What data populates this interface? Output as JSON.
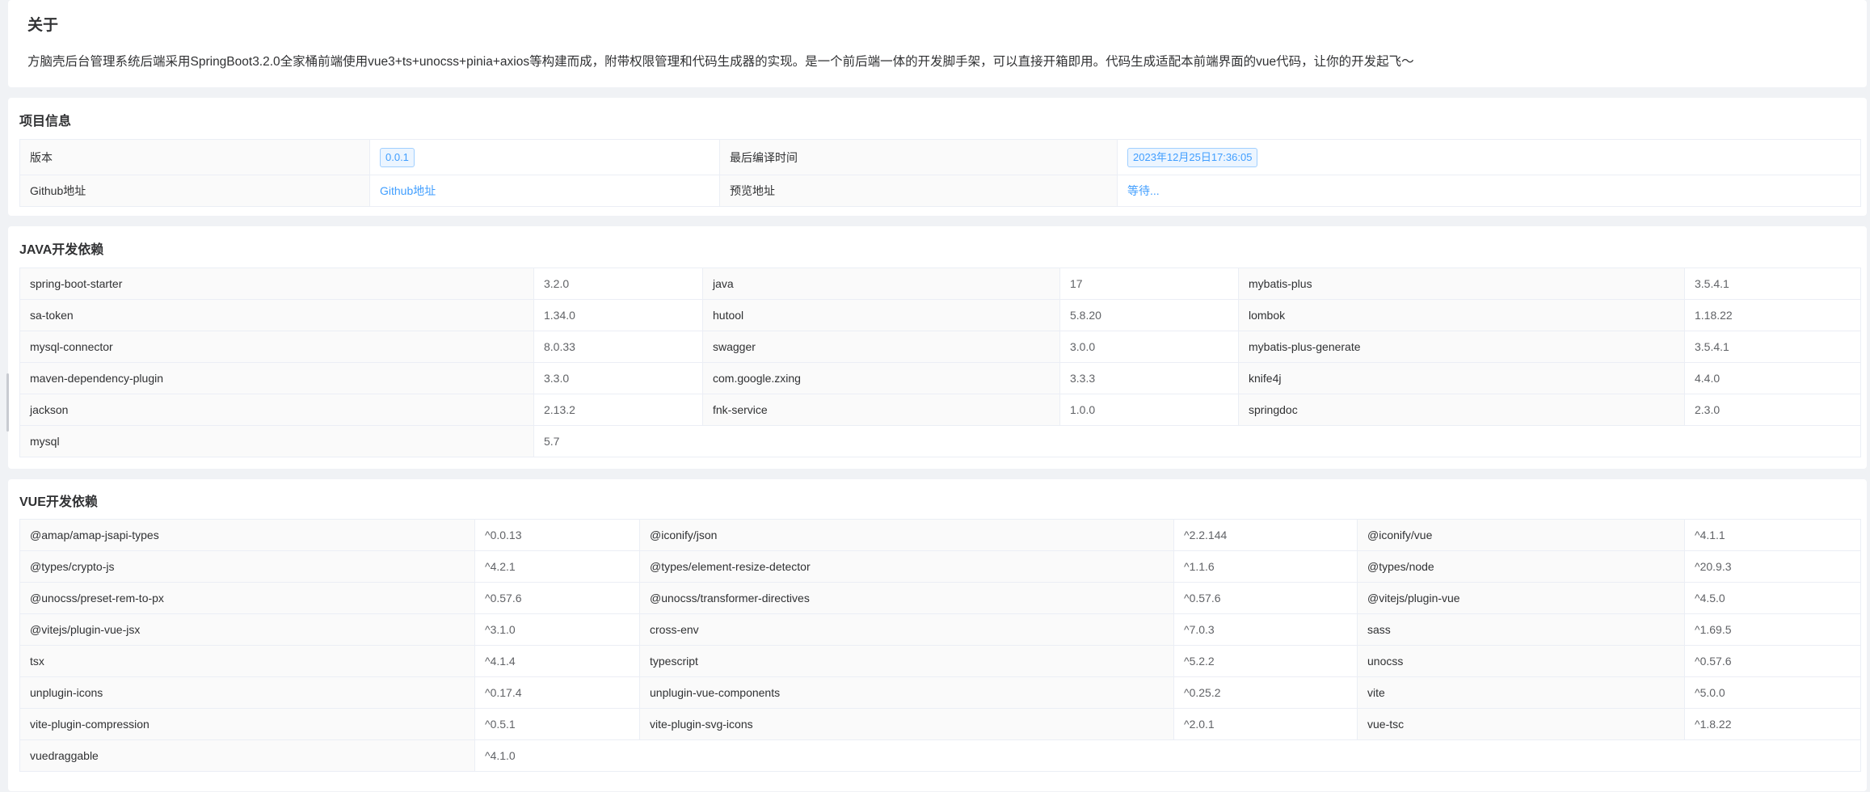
{
  "about": {
    "title": "关于",
    "text": "方脑壳后台管理系统后端采用SpringBoot3.2.0全家桶前端使用vue3+ts+unocss+pinia+axios等构建而成，附带权限管理和代码生成器的实现。是一个前后端一体的开发脚手架，可以直接开箱即用。代码生成适配本前端界面的vue代码，让你的开发起飞～"
  },
  "project": {
    "title": "项目信息",
    "version_label": "版本",
    "version_value": "0.0.1",
    "build_time_label": "最后编译时间",
    "build_time_value": "2023年12月25日17:36:05",
    "github_label": "Github地址",
    "github_value": "Github地址",
    "preview_label": "预览地址",
    "preview_value": "等待..."
  },
  "java": {
    "title": "JAVA开发依赖",
    "rows": [
      [
        [
          "spring-boot-starter",
          "3.2.0"
        ],
        [
          "java",
          "17"
        ],
        [
          "mybatis-plus",
          "3.5.4.1"
        ]
      ],
      [
        [
          "sa-token",
          "1.34.0"
        ],
        [
          "hutool",
          "5.8.20"
        ],
        [
          "lombok",
          "1.18.22"
        ]
      ],
      [
        [
          "mysql-connector",
          "8.0.33"
        ],
        [
          "swagger",
          "3.0.0"
        ],
        [
          "mybatis-plus-generate",
          "3.5.4.1"
        ]
      ],
      [
        [
          "maven-dependency-plugin",
          "3.3.0"
        ],
        [
          "com.google.zxing",
          "3.3.3"
        ],
        [
          "knife4j",
          "4.4.0"
        ]
      ],
      [
        [
          "jackson",
          "2.13.2"
        ],
        [
          "fnk-service",
          "1.0.0"
        ],
        [
          "springdoc",
          "2.3.0"
        ]
      ],
      [
        [
          "mysql",
          "5.7"
        ]
      ]
    ]
  },
  "vue": {
    "title": "VUE开发依赖",
    "rows": [
      [
        [
          "@amap/amap-jsapi-types",
          "^0.0.13"
        ],
        [
          "@iconify/json",
          "^2.2.144"
        ],
        [
          "@iconify/vue",
          "^4.1.1"
        ]
      ],
      [
        [
          "@types/crypto-js",
          "^4.2.1"
        ],
        [
          "@types/element-resize-detector",
          "^1.1.6"
        ],
        [
          "@types/node",
          "^20.9.3"
        ]
      ],
      [
        [
          "@unocss/preset-rem-to-px",
          "^0.57.6"
        ],
        [
          "@unocss/transformer-directives",
          "^0.57.6"
        ],
        [
          "@vitejs/plugin-vue",
          "^4.5.0"
        ]
      ],
      [
        [
          "@vitejs/plugin-vue-jsx",
          "^3.1.0"
        ],
        [
          "cross-env",
          "^7.0.3"
        ],
        [
          "sass",
          "^1.69.5"
        ]
      ],
      [
        [
          "tsx",
          "^4.1.4"
        ],
        [
          "typescript",
          "^5.2.2"
        ],
        [
          "unocss",
          "^0.57.6"
        ]
      ],
      [
        [
          "unplugin-icons",
          "^0.17.4"
        ],
        [
          "unplugin-vue-components",
          "^0.25.2"
        ],
        [
          "vite",
          "^5.0.0"
        ]
      ],
      [
        [
          "vite-plugin-compression",
          "^0.5.1"
        ],
        [
          "vite-plugin-svg-icons",
          "^2.0.1"
        ],
        [
          "vue-tsc",
          "^1.8.22"
        ]
      ],
      [
        [
          "vuedraggable",
          "^4.1.0"
        ]
      ]
    ]
  }
}
